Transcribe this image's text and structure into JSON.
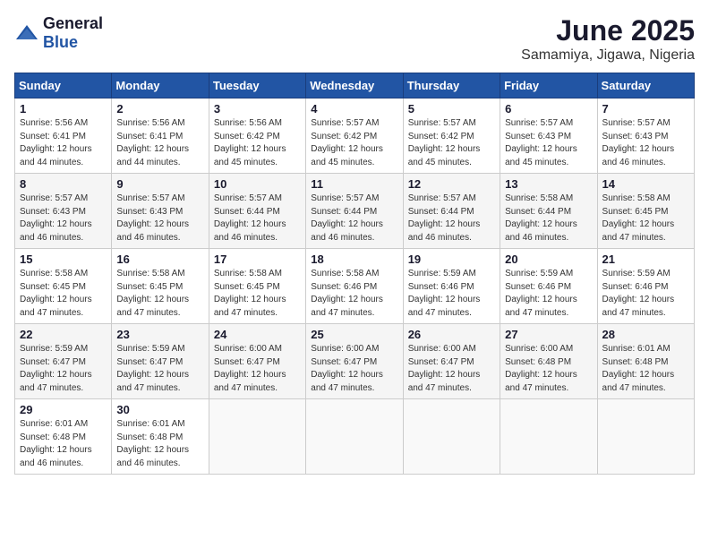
{
  "logo": {
    "general": "General",
    "blue": "Blue"
  },
  "header": {
    "month": "June 2025",
    "location": "Samamiya, Jigawa, Nigeria"
  },
  "weekdays": [
    "Sunday",
    "Monday",
    "Tuesday",
    "Wednesday",
    "Thursday",
    "Friday",
    "Saturday"
  ],
  "weeks": [
    [
      {
        "day": "1",
        "sunrise": "5:56 AM",
        "sunset": "6:41 PM",
        "daylight": "12 hours and 44 minutes."
      },
      {
        "day": "2",
        "sunrise": "5:56 AM",
        "sunset": "6:41 PM",
        "daylight": "12 hours and 44 minutes."
      },
      {
        "day": "3",
        "sunrise": "5:56 AM",
        "sunset": "6:42 PM",
        "daylight": "12 hours and 45 minutes."
      },
      {
        "day": "4",
        "sunrise": "5:57 AM",
        "sunset": "6:42 PM",
        "daylight": "12 hours and 45 minutes."
      },
      {
        "day": "5",
        "sunrise": "5:57 AM",
        "sunset": "6:42 PM",
        "daylight": "12 hours and 45 minutes."
      },
      {
        "day": "6",
        "sunrise": "5:57 AM",
        "sunset": "6:43 PM",
        "daylight": "12 hours and 45 minutes."
      },
      {
        "day": "7",
        "sunrise": "5:57 AM",
        "sunset": "6:43 PM",
        "daylight": "12 hours and 46 minutes."
      }
    ],
    [
      {
        "day": "8",
        "sunrise": "5:57 AM",
        "sunset": "6:43 PM",
        "daylight": "12 hours and 46 minutes."
      },
      {
        "day": "9",
        "sunrise": "5:57 AM",
        "sunset": "6:43 PM",
        "daylight": "12 hours and 46 minutes."
      },
      {
        "day": "10",
        "sunrise": "5:57 AM",
        "sunset": "6:44 PM",
        "daylight": "12 hours and 46 minutes."
      },
      {
        "day": "11",
        "sunrise": "5:57 AM",
        "sunset": "6:44 PM",
        "daylight": "12 hours and 46 minutes."
      },
      {
        "day": "12",
        "sunrise": "5:57 AM",
        "sunset": "6:44 PM",
        "daylight": "12 hours and 46 minutes."
      },
      {
        "day": "13",
        "sunrise": "5:58 AM",
        "sunset": "6:44 PM",
        "daylight": "12 hours and 46 minutes."
      },
      {
        "day": "14",
        "sunrise": "5:58 AM",
        "sunset": "6:45 PM",
        "daylight": "12 hours and 47 minutes."
      }
    ],
    [
      {
        "day": "15",
        "sunrise": "5:58 AM",
        "sunset": "6:45 PM",
        "daylight": "12 hours and 47 minutes."
      },
      {
        "day": "16",
        "sunrise": "5:58 AM",
        "sunset": "6:45 PM",
        "daylight": "12 hours and 47 minutes."
      },
      {
        "day": "17",
        "sunrise": "5:58 AM",
        "sunset": "6:45 PM",
        "daylight": "12 hours and 47 minutes."
      },
      {
        "day": "18",
        "sunrise": "5:58 AM",
        "sunset": "6:46 PM",
        "daylight": "12 hours and 47 minutes."
      },
      {
        "day": "19",
        "sunrise": "5:59 AM",
        "sunset": "6:46 PM",
        "daylight": "12 hours and 47 minutes."
      },
      {
        "day": "20",
        "sunrise": "5:59 AM",
        "sunset": "6:46 PM",
        "daylight": "12 hours and 47 minutes."
      },
      {
        "day": "21",
        "sunrise": "5:59 AM",
        "sunset": "6:46 PM",
        "daylight": "12 hours and 47 minutes."
      }
    ],
    [
      {
        "day": "22",
        "sunrise": "5:59 AM",
        "sunset": "6:47 PM",
        "daylight": "12 hours and 47 minutes."
      },
      {
        "day": "23",
        "sunrise": "5:59 AM",
        "sunset": "6:47 PM",
        "daylight": "12 hours and 47 minutes."
      },
      {
        "day": "24",
        "sunrise": "6:00 AM",
        "sunset": "6:47 PM",
        "daylight": "12 hours and 47 minutes."
      },
      {
        "day": "25",
        "sunrise": "6:00 AM",
        "sunset": "6:47 PM",
        "daylight": "12 hours and 47 minutes."
      },
      {
        "day": "26",
        "sunrise": "6:00 AM",
        "sunset": "6:47 PM",
        "daylight": "12 hours and 47 minutes."
      },
      {
        "day": "27",
        "sunrise": "6:00 AM",
        "sunset": "6:48 PM",
        "daylight": "12 hours and 47 minutes."
      },
      {
        "day": "28",
        "sunrise": "6:01 AM",
        "sunset": "6:48 PM",
        "daylight": "12 hours and 47 minutes."
      }
    ],
    [
      {
        "day": "29",
        "sunrise": "6:01 AM",
        "sunset": "6:48 PM",
        "daylight": "12 hours and 46 minutes."
      },
      {
        "day": "30",
        "sunrise": "6:01 AM",
        "sunset": "6:48 PM",
        "daylight": "12 hours and 46 minutes."
      },
      null,
      null,
      null,
      null,
      null
    ]
  ],
  "labels": {
    "sunrise": "Sunrise:",
    "sunset": "Sunset:",
    "daylight": "Daylight:"
  }
}
